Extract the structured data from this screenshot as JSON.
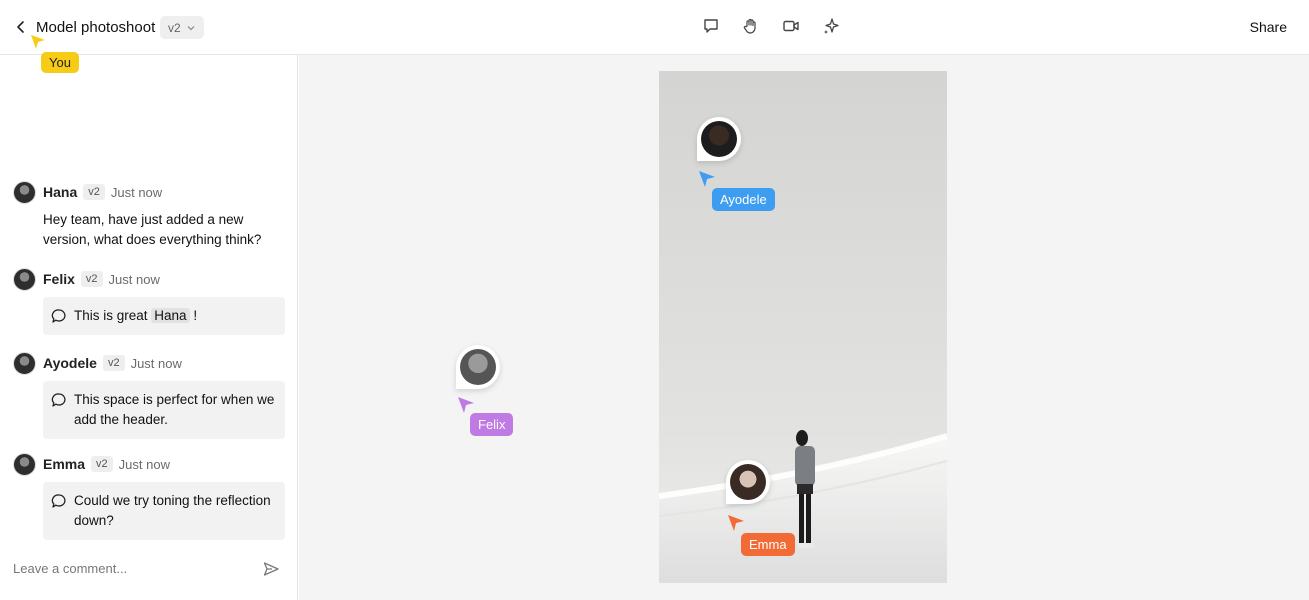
{
  "header": {
    "title": "Model photoshoot",
    "version": "v2",
    "share_label": "Share"
  },
  "toolbar": {
    "tools": [
      "comment-icon",
      "hand-icon",
      "video-icon",
      "sparkle-icon"
    ]
  },
  "self_cursor": {
    "label": "You",
    "color": "#f7cc16"
  },
  "comments": [
    {
      "author": "Hana",
      "version": "v2",
      "time": "Just now",
      "text": "Hey team, have just added a new version, what does everything think?"
    },
    {
      "author": "Felix",
      "version": "v2",
      "time": "Just now",
      "text_before": "This is great",
      "mention": "Hana",
      "text_after": "!"
    },
    {
      "author": "Ayodele",
      "version": "v2",
      "time": "Just now",
      "text": "This space is perfect for when we add the header."
    },
    {
      "author": "Emma",
      "version": "v2",
      "time": "Just now",
      "text": "Could we try toning the reflection down?"
    }
  ],
  "comment_input": {
    "placeholder": "Leave a comment..."
  },
  "canvas_cursors": [
    {
      "name": "Ayodele",
      "color": "#3d9df0"
    },
    {
      "name": "Felix",
      "color": "#c07ae3"
    },
    {
      "name": "Emma",
      "color": "#f26a35"
    }
  ]
}
